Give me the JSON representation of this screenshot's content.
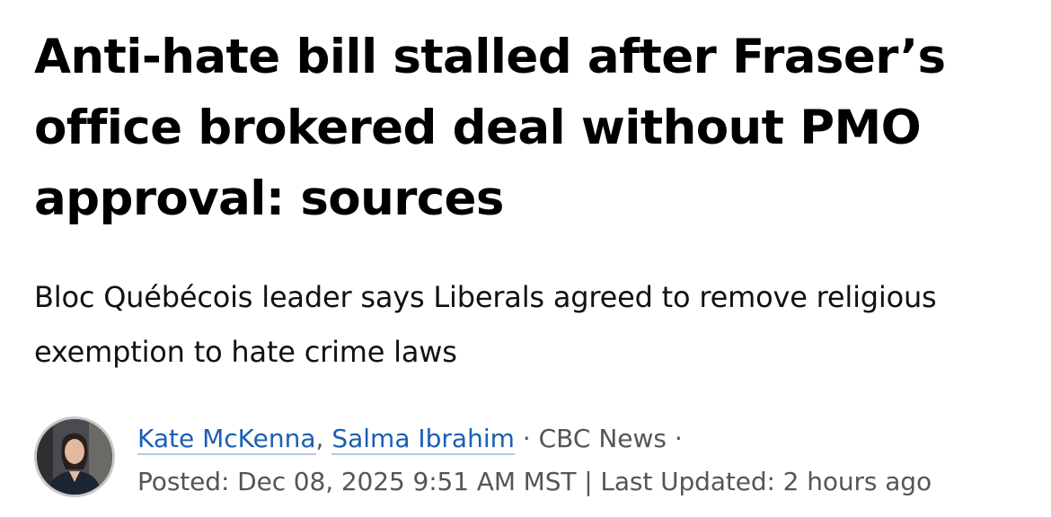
{
  "article": {
    "headline": "Anti-hate bill stalled after Fraser’s office brokered deal without PMO approval: sources",
    "deck": "Bloc Québécois leader says Liberals agreed to remove religious exemption to hate crime laws",
    "byline": {
      "authors": [
        "Kate McKenna",
        "Salma Ibrahim"
      ],
      "author_separator": ", ",
      "source_separator": " · ",
      "source": "CBC News",
      "trailing_separator": " ·",
      "timestamp": "Posted: Dec 08, 2025 9:51 AM MST | Last Updated: 2 hours ago"
    }
  },
  "colors": {
    "link": "#1a5fb4",
    "meta_text": "#555555",
    "headline_text": "#000000"
  },
  "icons": {
    "avatar": "author-photo"
  }
}
